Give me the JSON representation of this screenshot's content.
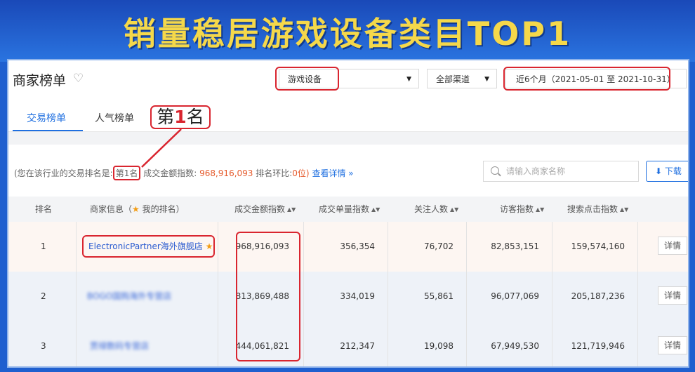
{
  "banner": {
    "title": "销量稳居游戏设备类目TOP1"
  },
  "header": {
    "title": "商家榜单",
    "category_select": "游戏设备",
    "channel_select": "全部渠道",
    "date_range": "近6个月（2021-05-01 至 2021-10-31）"
  },
  "tabs": [
    {
      "label": "交易榜单",
      "active": true
    },
    {
      "label": "人气榜单",
      "active": false
    }
  ],
  "annotation": {
    "rank_label_prefix": "第",
    "rank_label_number": "1",
    "rank_label_suffix": "名"
  },
  "summary": {
    "prefix": "(您在该行业的交易排名是:",
    "rank": "第1名",
    "amount_label": "成交金额指数:",
    "amount_value": "968,916,093",
    "ratio_label": "排名环比:",
    "ratio_value": "0位)",
    "link": "查看详情 »"
  },
  "search": {
    "placeholder": "请输入商家名称"
  },
  "download": {
    "label": "下载"
  },
  "table": {
    "columns": {
      "rank": "排名",
      "merchant_prefix": "商家信息（",
      "merchant_suffix": "我的排名）",
      "amount": "成交金额指数",
      "orders": "成交单量指数",
      "followers": "关注人数",
      "visitors": "访客指数",
      "search_clicks": "搜索点击指数"
    },
    "rows": [
      {
        "rank": "1",
        "merchant": "ElectronicPartner海外旗舰店",
        "amount": "968,916,093",
        "orders": "356,354",
        "followers": "76,702",
        "visitors": "82,853,151",
        "search_clicks": "159,574,160",
        "detail": "详情"
      },
      {
        "rank": "2",
        "merchant": "BOGO国购海外专营店",
        "amount": "813,869,488",
        "orders": "334,019",
        "followers": "55,861",
        "visitors": "96,077,069",
        "search_clicks": "205,187,236",
        "detail": "详情"
      },
      {
        "rank": "3",
        "merchant": "贾禄数码专营店",
        "amount": "444,061,821",
        "orders": "212,347",
        "followers": "19,098",
        "visitors": "67,949,530",
        "search_clicks": "121,719,946",
        "detail": "详情"
      }
    ]
  },
  "colors": {
    "accent": "#1f6fe0",
    "highlight": "#d9252f",
    "banner_text": "#f5d84a"
  },
  "icons": {
    "heart": "heart-icon",
    "star": "star-icon",
    "sort": "sort-icon",
    "search": "search-icon",
    "download": "download-icon",
    "caret": "caret-down-icon"
  }
}
